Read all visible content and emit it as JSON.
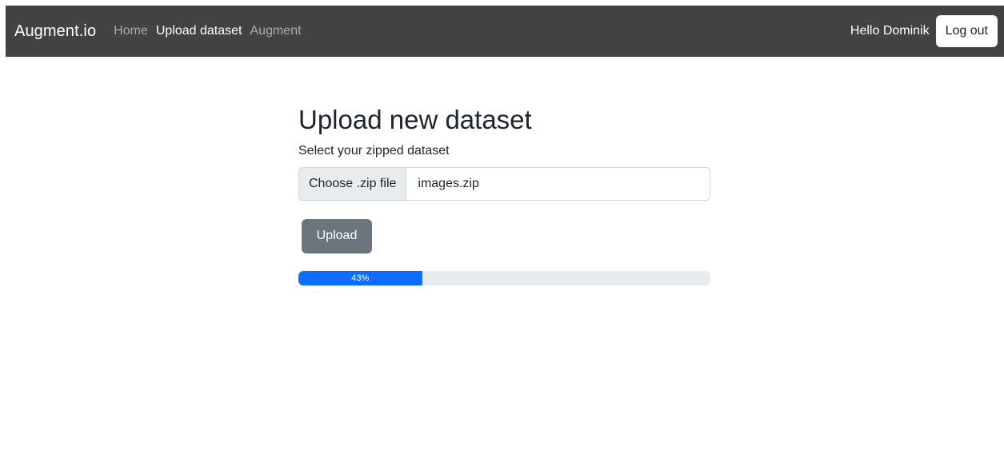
{
  "navbar": {
    "brand": "Augment.io",
    "links": [
      {
        "label": "Home",
        "active": false
      },
      {
        "label": "Upload dataset",
        "active": true
      },
      {
        "label": "Augment",
        "active": false
      }
    ],
    "greeting": "Hello Dominik",
    "logout_label": "Log out",
    "background": "#434343"
  },
  "main": {
    "title": "Upload new dataset",
    "subtitle": "Select your zipped dataset",
    "file_input": {
      "button_label": "Choose .zip file",
      "value": "images.zip"
    },
    "upload_label": "Upload",
    "progress": {
      "value": 0.3,
      "label": "43%",
      "color": "#0d6efd"
    }
  }
}
